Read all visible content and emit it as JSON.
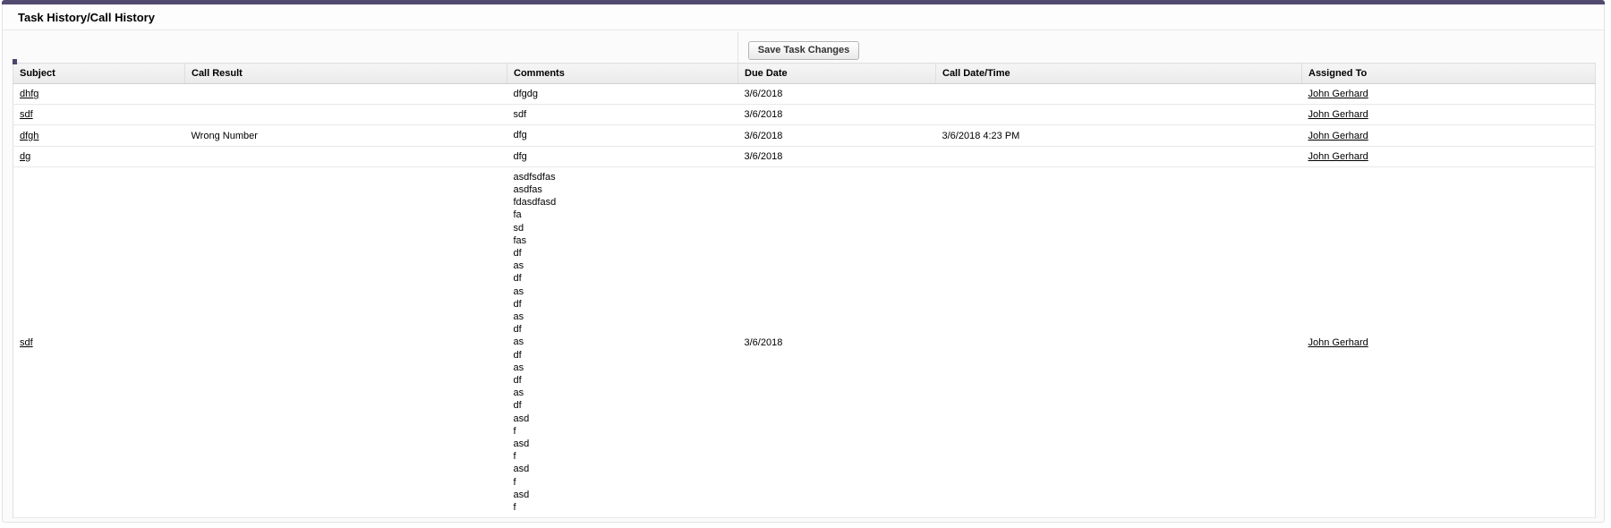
{
  "panel": {
    "title": "Task History/Call History",
    "accent_color": "#534a70",
    "save_button_label": "Save Task Changes"
  },
  "table": {
    "columns": [
      {
        "key": "subject",
        "label": "Subject"
      },
      {
        "key": "call_result",
        "label": "Call Result"
      },
      {
        "key": "comments",
        "label": "Comments"
      },
      {
        "key": "due_date",
        "label": "Due Date"
      },
      {
        "key": "call_datetime",
        "label": "Call Date/Time"
      },
      {
        "key": "assigned_to",
        "label": "Assigned To"
      }
    ],
    "rows": [
      {
        "subject": "dhfg",
        "call_result": "",
        "comments": "dfgdg",
        "due_date": "3/6/2018",
        "call_datetime": "",
        "assigned_to": "John Gerhard"
      },
      {
        "subject": "sdf",
        "call_result": "",
        "comments": "sdf",
        "due_date": "3/6/2018",
        "call_datetime": "",
        "assigned_to": "John Gerhard"
      },
      {
        "subject": "dfgh",
        "call_result": "Wrong Number",
        "comments": "dfg",
        "due_date": "3/6/2018",
        "call_datetime": "3/6/2018 4:23 PM",
        "assigned_to": "John Gerhard"
      },
      {
        "subject": "dg",
        "call_result": "",
        "comments": "dfg",
        "due_date": "3/6/2018",
        "call_datetime": "",
        "assigned_to": "John Gerhard"
      },
      {
        "subject": "sdf",
        "call_result": "",
        "comments": "asdfsdfas\nasdfas\nfdasdfasd\nfa\nsd\nfas\ndf\nas\ndf\nas\ndf\nas\ndf\nas\ndf\nas\ndf\nas\ndf\nasd\nf\nasd\nf\nasd\nf\nasd\nf",
        "due_date": "3/6/2018",
        "call_datetime": "",
        "assigned_to": "John Gerhard"
      }
    ]
  }
}
